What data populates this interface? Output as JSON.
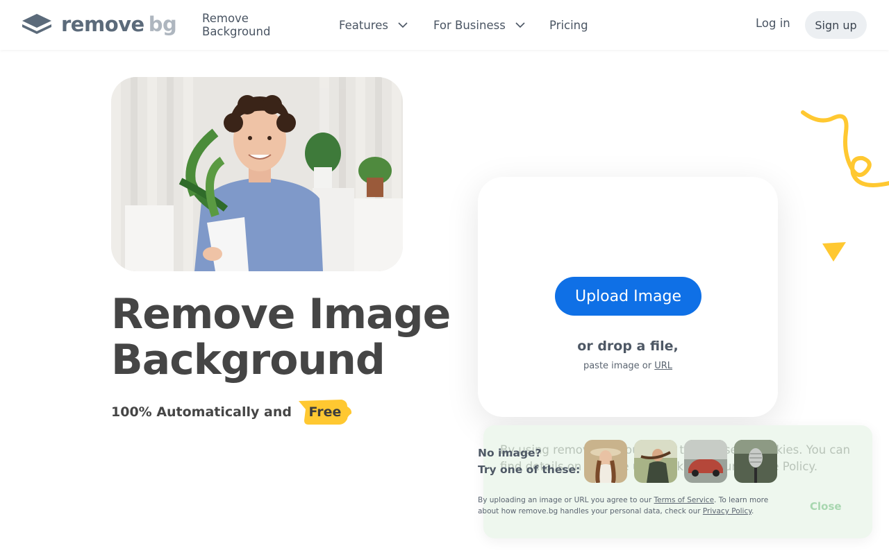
{
  "header": {
    "logo_main": "remove",
    "logo_accent": "bg",
    "nav": {
      "remove_background": "Remove Background",
      "features": "Features",
      "for_business": "For Business",
      "pricing": "Pricing"
    },
    "login": "Log in",
    "signup": "Sign up"
  },
  "hero": {
    "title_line1": "Remove Image",
    "title_line2": "Background",
    "subtitle": "100% Automatically and",
    "badge": "Free"
  },
  "upload": {
    "button": "Upload Image",
    "drop": "or drop a file,",
    "paste_prefix": "paste image or",
    "paste_link": "URL"
  },
  "samples": {
    "label_line1": "No image?",
    "label_line2": "Try one of these:",
    "thumbs": [
      "woman-hat-thumbnail",
      "person-with-animal-thumbnail",
      "car-thumbnail",
      "microphone-thumbnail"
    ]
  },
  "terms": {
    "p1": "By uploading an image or URL you agree to our",
    "tos": "Terms of Service",
    "p2": ". To learn more about how remove.bg handles your personal data, check our",
    "privacy": "Privacy Policy",
    "p3": "."
  },
  "cookie": {
    "text": "By using remove.bg you agree to the use of cookies. You can find details on how we use cookies in our Cookie Policy.",
    "close": "Close"
  },
  "colors": {
    "accent_blue": "#0f70e6",
    "badge_yellow": "#ffc831",
    "text_dark": "#454545"
  }
}
